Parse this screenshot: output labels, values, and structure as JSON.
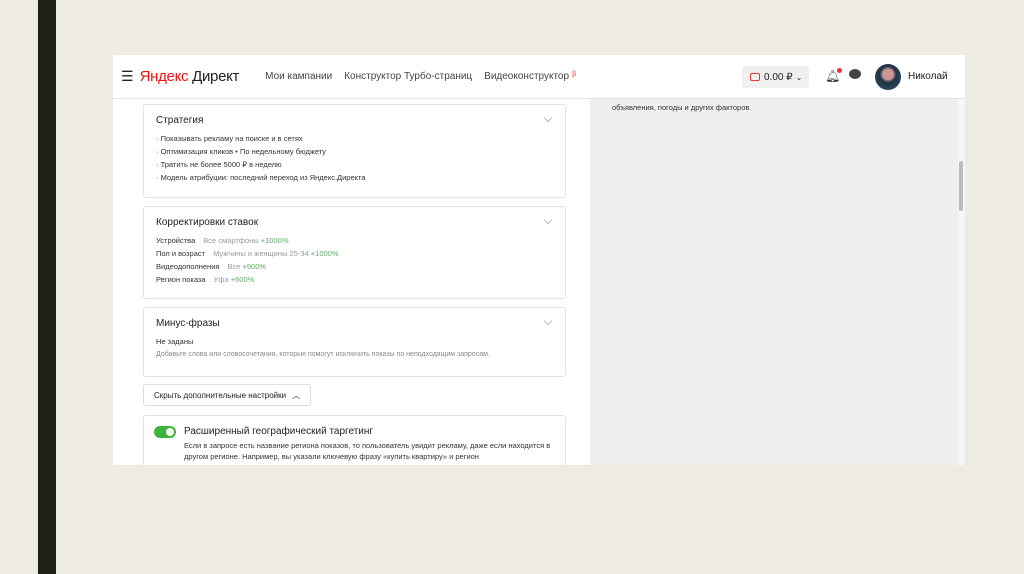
{
  "header": {
    "logo_brand": "Яндекс",
    "logo_product": "Директ",
    "nav": [
      "Мои кампании",
      "Конструктор Турбо-страниц",
      "Видеоконструктор"
    ],
    "nav_badge": "β",
    "balance": "0.00 ₽",
    "user": "Николай"
  },
  "right_panel": {
    "text": "объявления, погоды и других факторов."
  },
  "strategy": {
    "title": "Стратегия",
    "items": [
      "Показывать рекламу на поиске и в сетях",
      "Оптимизация кликов • По недельному бюджету",
      "Тратить не более 5000 ₽ в неделю",
      "Модель атрибуции: последний переход из Яндекс.Директа"
    ]
  },
  "bids": {
    "title": "Корректировки ставок",
    "rows": [
      {
        "label": "Устройства",
        "value": "Все смартфоны",
        "pct": "+1000%"
      },
      {
        "label": "Пол и возраст",
        "value": "Мужчины и женщины 25-34",
        "pct": "+1000%"
      },
      {
        "label": "Видеодополнения",
        "value": "Все",
        "pct": "+900%"
      },
      {
        "label": "Регион показа",
        "value": "Уфа",
        "pct": "+600%"
      }
    ]
  },
  "minus": {
    "title": "Минус-фразы",
    "status": "Не заданы",
    "hint": "Добавьте слова или словосочетания, которые помогут исключить показы по неподходящим запросам."
  },
  "hide_button": "Скрыть дополнительные настройки",
  "geo": {
    "title": "Расширенный географический таргетинг",
    "enabled": true,
    "text": "Если в запросе есть название региона показов, то пользователь увидит рекламу, даже если находится в другом регионе. Например, вы указали ключевую фразу «купить квартиру» и регион"
  }
}
